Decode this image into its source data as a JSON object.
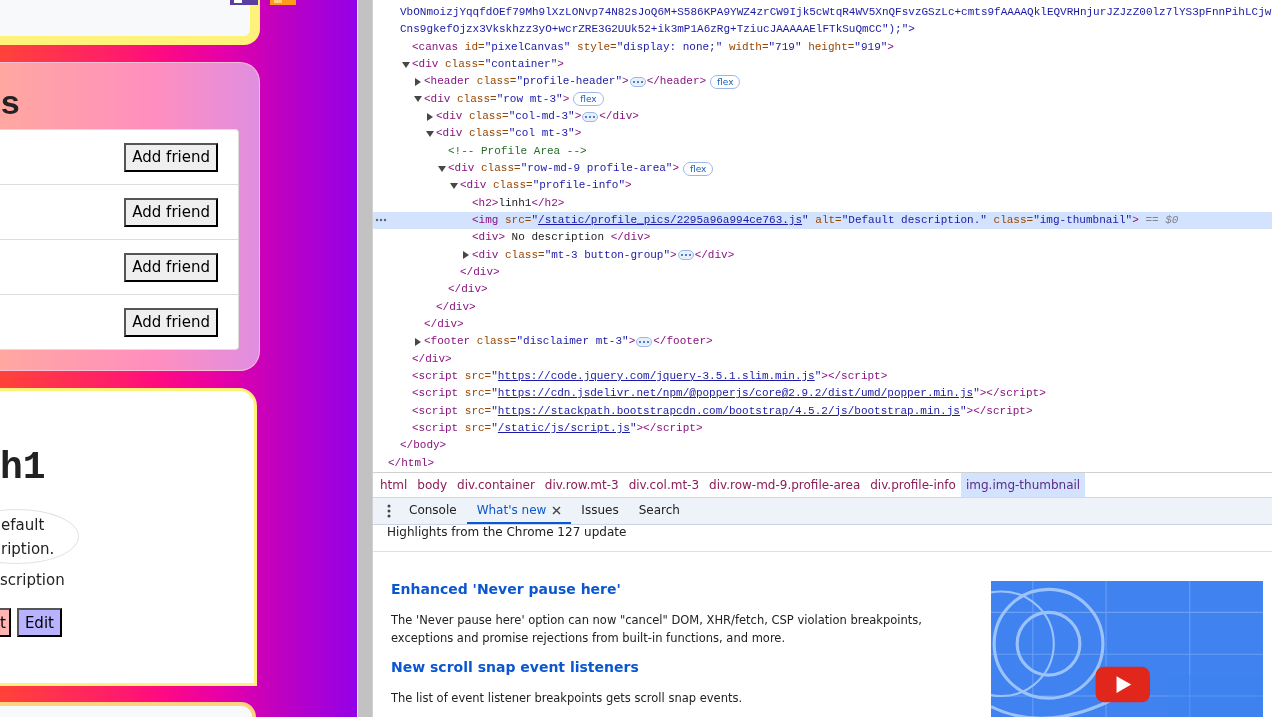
{
  "web_page": {
    "friends": {
      "heading": "s",
      "rows": [
        {
          "button": "Add friend"
        },
        {
          "button": "Add friend"
        },
        {
          "button": "Add friend"
        },
        {
          "button": "Add friend"
        }
      ]
    },
    "profile": {
      "name": "h1",
      "image_alt_lines": [
        "efault",
        "ription."
      ],
      "description": "scription",
      "buttons": [
        {
          "label": "t",
          "color": "#ffb3b3"
        },
        {
          "label": "Edit",
          "color": "#b9b3ff"
        }
      ]
    }
  },
  "devtools": {
    "elements": {
      "overflow_lines": [
        "VbONmoizjYqqfdOEf79Mh9lXzLONvp74N82sJoQ6M+S586KPA9YWZ4zrCW9Ijk5cWtqR4WV5XnQFsvzGSzLc+cmts9fAAAAQklEQVRHnjurJZJzZ00lz7lYS3pFnnPihLCjw",
        "Cns9gkefOjzx3Vkskhzz3yO+wcrZRE3G2UUk52+ik3mP1A6zRg+TziucJAAAAAElFTkSuQmCC\");\">"
      ],
      "tree": [
        {
          "closing": [
            {
              "kind": "tag",
              "text": "</html>"
            }
          ],
          "children": [
            {
              "closing": [
                {
                  "kind": "tag",
                  "text": "</body>"
                }
              ],
              "children": [
                {
                  "selected": false,
                  "parts": [
                    {
                      "kind": "tag",
                      "text": "<canvas"
                    },
                    {
                      "kind": "attr",
                      "text": " id="
                    },
                    {
                      "kind": "val",
                      "text": "\"pixelCanvas\""
                    },
                    {
                      "kind": "attr",
                      "text": " style="
                    },
                    {
                      "kind": "val",
                      "text": "\"display: none;\""
                    },
                    {
                      "kind": "attr",
                      "text": " width="
                    },
                    {
                      "kind": "val",
                      "text": "\"719\""
                    },
                    {
                      "kind": "attr",
                      "text": " height="
                    },
                    {
                      "kind": "val",
                      "text": "\"919\""
                    },
                    {
                      "kind": "tag",
                      "text": ">"
                    }
                  ]
                },
                {
                  "selected": false,
                  "expanded": true,
                  "parts": [
                    {
                      "kind": "tag",
                      "text": "<div"
                    },
                    {
                      "kind": "attr",
                      "text": " class="
                    },
                    {
                      "kind": "val",
                      "text": "\"container\""
                    },
                    {
                      "kind": "tag",
                      "text": ">"
                    }
                  ],
                  "closing": [
                    {
                      "kind": "tag",
                      "text": "</div>"
                    }
                  ],
                  "children": [
                    {
                      "selected": false,
                      "expanded": false,
                      "parts": [
                        {
                          "kind": "tag",
                          "text": "<header"
                        },
                        {
                          "kind": "attr",
                          "text": " class="
                        },
                        {
                          "kind": "val",
                          "text": "\"profile-header\""
                        },
                        {
                          "kind": "tag",
                          "text": ">"
                        },
                        {
                          "kind": "more"
                        },
                        {
                          "kind": "tag",
                          "text": "</header>"
                        },
                        {
                          "kind": "badge",
                          "text": "flex"
                        }
                      ]
                    },
                    {
                      "selected": false,
                      "expanded": true,
                      "parts": [
                        {
                          "kind": "tag",
                          "text": "<div"
                        },
                        {
                          "kind": "attr",
                          "text": " class="
                        },
                        {
                          "kind": "val",
                          "text": "\"row mt-3\""
                        },
                        {
                          "kind": "tag",
                          "text": ">"
                        },
                        {
                          "kind": "badge",
                          "text": "flex"
                        }
                      ],
                      "closing": [
                        {
                          "kind": "tag",
                          "text": "</div>"
                        }
                      ],
                      "children": [
                        {
                          "selected": false,
                          "expanded": false,
                          "parts": [
                            {
                              "kind": "tag",
                              "text": "<div"
                            },
                            {
                              "kind": "attr",
                              "text": " class="
                            },
                            {
                              "kind": "val",
                              "text": "\"col-md-3\""
                            },
                            {
                              "kind": "tag",
                              "text": ">"
                            },
                            {
                              "kind": "more"
                            },
                            {
                              "kind": "tag",
                              "text": "</div>"
                            }
                          ]
                        },
                        {
                          "selected": false,
                          "expanded": true,
                          "parts": [
                            {
                              "kind": "tag",
                              "text": "<div"
                            },
                            {
                              "kind": "attr",
                              "text": " class="
                            },
                            {
                              "kind": "val",
                              "text": "\"col mt-3\""
                            },
                            {
                              "kind": "tag",
                              "text": ">"
                            }
                          ],
                          "closing": [
                            {
                              "kind": "tag",
                              "text": "</div>"
                            }
                          ],
                          "children": [
                            {
                              "selected": false,
                              "parts": [
                                {
                                  "kind": "comment",
                                  "text": "<!-- Profile Area -->"
                                }
                              ]
                            },
                            {
                              "selected": false,
                              "expanded": true,
                              "parts": [
                                {
                                  "kind": "tag",
                                  "text": "<div"
                                },
                                {
                                  "kind": "attr",
                                  "text": " class="
                                },
                                {
                                  "kind": "val",
                                  "text": "\"row-md-9 profile-area\""
                                },
                                {
                                  "kind": "tag",
                                  "text": ">"
                                },
                                {
                                  "kind": "badge",
                                  "text": "flex"
                                }
                              ],
                              "closing": [
                                {
                                  "kind": "tag",
                                  "text": "</div>"
                                }
                              ],
                              "children": [
                                {
                                  "selected": false,
                                  "expanded": true,
                                  "parts": [
                                    {
                                      "kind": "tag",
                                      "text": "<div"
                                    },
                                    {
                                      "kind": "attr",
                                      "text": " class="
                                    },
                                    {
                                      "kind": "val",
                                      "text": "\"profile-info\""
                                    },
                                    {
                                      "kind": "tag",
                                      "text": ">"
                                    }
                                  ],
                                  "closing": [
                                    {
                                      "kind": "tag",
                                      "text": "</div>"
                                    }
                                  ],
                                  "children": [
                                    {
                                      "selected": false,
                                      "parts": [
                                        {
                                          "kind": "tag",
                                          "text": "<h2>"
                                        },
                                        {
                                          "kind": "text",
                                          "text": "linh1"
                                        },
                                        {
                                          "kind": "tag",
                                          "text": "</h2>"
                                        }
                                      ]
                                    },
                                    {
                                      "selected": true,
                                      "parts": [
                                        {
                                          "kind": "tag",
                                          "text": "<img"
                                        },
                                        {
                                          "kind": "attr",
                                          "text": " src="
                                        },
                                        {
                                          "kind": "val",
                                          "text": "\""
                                        },
                                        {
                                          "kind": "link",
                                          "text": "/static/profile_pics/2295a96a994ce763.js"
                                        },
                                        {
                                          "kind": "val",
                                          "text": "\""
                                        },
                                        {
                                          "kind": "attr",
                                          "text": " alt="
                                        },
                                        {
                                          "kind": "val",
                                          "text": "\"Default description.\""
                                        },
                                        {
                                          "kind": "attr",
                                          "text": " class="
                                        },
                                        {
                                          "kind": "val",
                                          "text": "\"img-thumbnail\""
                                        },
                                        {
                                          "kind": "tag",
                                          "text": ">"
                                        },
                                        {
                                          "kind": "eq",
                                          "text": " == $0"
                                        }
                                      ]
                                    },
                                    {
                                      "selected": false,
                                      "parts": [
                                        {
                                          "kind": "tag",
                                          "text": "<div>"
                                        },
                                        {
                                          "kind": "text",
                                          "text": " No description "
                                        },
                                        {
                                          "kind": "tag",
                                          "text": "</div>"
                                        }
                                      ]
                                    },
                                    {
                                      "selected": false,
                                      "expanded": false,
                                      "parts": [
                                        {
                                          "kind": "tag",
                                          "text": "<div"
                                        },
                                        {
                                          "kind": "attr",
                                          "text": " class="
                                        },
                                        {
                                          "kind": "val",
                                          "text": "\"mt-3 button-group\""
                                        },
                                        {
                                          "kind": "tag",
                                          "text": ">"
                                        },
                                        {
                                          "kind": "more"
                                        },
                                        {
                                          "kind": "tag",
                                          "text": "</div>"
                                        }
                                      ]
                                    }
                                  ]
                                }
                              ]
                            }
                          ]
                        }
                      ]
                    },
                    {
                      "selected": false,
                      "expanded": false,
                      "parts": [
                        {
                          "kind": "tag",
                          "text": "<footer"
                        },
                        {
                          "kind": "attr",
                          "text": " class="
                        },
                        {
                          "kind": "val",
                          "text": "\"disclaimer mt-3\""
                        },
                        {
                          "kind": "tag",
                          "text": ">"
                        },
                        {
                          "kind": "more"
                        },
                        {
                          "kind": "tag",
                          "text": "</footer>"
                        }
                      ]
                    }
                  ]
                },
                {
                  "selected": false,
                  "parts": [
                    {
                      "kind": "tag",
                      "text": "<script"
                    },
                    {
                      "kind": "attr",
                      "text": " src="
                    },
                    {
                      "kind": "val",
                      "text": "\""
                    },
                    {
                      "kind": "link",
                      "text": "https://code.jquery.com/jquery-3.5.1.slim.min.js"
                    },
                    {
                      "kind": "val",
                      "text": "\""
                    },
                    {
                      "kind": "tag",
                      "text": "></script>"
                    }
                  ]
                },
                {
                  "selected": false,
                  "parts": [
                    {
                      "kind": "tag",
                      "text": "<script"
                    },
                    {
                      "kind": "attr",
                      "text": " src="
                    },
                    {
                      "kind": "val",
                      "text": "\""
                    },
                    {
                      "kind": "link",
                      "text": "https://cdn.jsdelivr.net/npm/@popperjs/core@2.9.2/dist/umd/popper.min.js"
                    },
                    {
                      "kind": "val",
                      "text": "\""
                    },
                    {
                      "kind": "tag",
                      "text": "></script>"
                    }
                  ]
                },
                {
                  "selected": false,
                  "parts": [
                    {
                      "kind": "tag",
                      "text": "<script"
                    },
                    {
                      "kind": "attr",
                      "text": " src="
                    },
                    {
                      "kind": "val",
                      "text": "\""
                    },
                    {
                      "kind": "link",
                      "text": "https://stackpath.bootstrapcdn.com/bootstrap/4.5.2/js/bootstrap.min.js"
                    },
                    {
                      "kind": "val",
                      "text": "\""
                    },
                    {
                      "kind": "tag",
                      "text": "></script>"
                    }
                  ]
                },
                {
                  "selected": false,
                  "parts": [
                    {
                      "kind": "tag",
                      "text": "<script"
                    },
                    {
                      "kind": "attr",
                      "text": " src="
                    },
                    {
                      "kind": "val",
                      "text": "\""
                    },
                    {
                      "kind": "link",
                      "text": "/static/js/script.js"
                    },
                    {
                      "kind": "val",
                      "text": "\""
                    },
                    {
                      "kind": "tag",
                      "text": "></script>"
                    }
                  ]
                }
              ]
            }
          ]
        }
      ]
    },
    "breadcrumbs": [
      {
        "label": "html",
        "selected": false
      },
      {
        "label": "body",
        "selected": false
      },
      {
        "label": "div.container",
        "selected": false
      },
      {
        "label": "div.row.mt-3",
        "selected": false
      },
      {
        "label": "div.col.mt-3",
        "selected": false
      },
      {
        "label": "div.row-md-9.profile-area",
        "selected": false
      },
      {
        "label": "div.profile-info",
        "selected": false
      },
      {
        "label": "img.img-thumbnail",
        "selected": true
      }
    ],
    "drawer_tabs": [
      {
        "label": "Console",
        "selected": false,
        "closable": false
      },
      {
        "label": "What's new",
        "selected": true,
        "closable": true
      },
      {
        "label": "Issues",
        "selected": false,
        "closable": false
      },
      {
        "label": "Search",
        "selected": false,
        "closable": false
      }
    ],
    "whats_new": {
      "subtitle": "Highlights from the Chrome 127 update",
      "articles": [
        {
          "title": "Enhanced 'Never pause here'",
          "body": "The 'Never pause here' option can now \"cancel\" DOM, XHR/fetch, CSP violation breakpoints, exceptions and promise rejections from built-in functions, and more."
        },
        {
          "title": "New scroll snap event listeners",
          "body": "The list of event listener breakpoints gets scroll snap events."
        }
      ]
    }
  }
}
